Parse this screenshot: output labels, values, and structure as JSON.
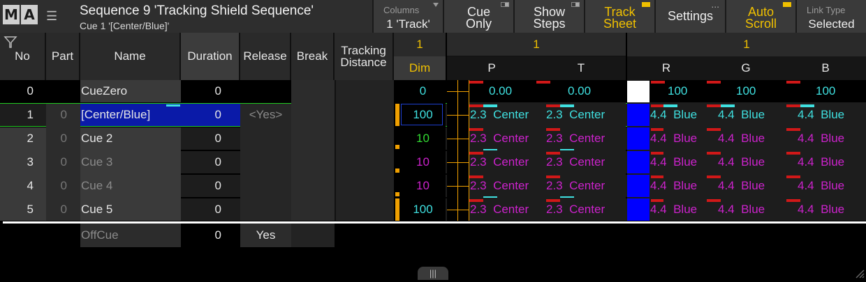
{
  "logo": [
    "M",
    "A"
  ],
  "title": {
    "sequence": "Sequence 9 'Tracking Shield Sequence'",
    "cue": "Cue 1 '[Center/Blue]'"
  },
  "toolbar": {
    "columns_caption": "Columns",
    "columns_value": "1 'Track'",
    "cue_only": [
      "Cue",
      "Only"
    ],
    "show_steps": [
      "Show",
      "Steps"
    ],
    "track_sheet": [
      "Track",
      "Sheet"
    ],
    "settings": "Settings",
    "auto_scroll": [
      "Auto",
      "Scroll"
    ],
    "link_type_caption": "Link Type",
    "link_type_value": "Selected"
  },
  "headers": {
    "no": "No",
    "part": "Part",
    "name": "Name",
    "duration": "Duration",
    "release": "Release",
    "break": "Break",
    "tracking_distance": [
      "Tracking",
      "Distance"
    ],
    "fixture_ids": [
      "1",
      "1",
      "1"
    ],
    "dim": "Dim",
    "position_attrs": [
      "P",
      "T"
    ],
    "color_attrs": [
      "R",
      "G",
      "B"
    ]
  },
  "rows": [
    {
      "no": "0",
      "part": "",
      "name": "CueZero",
      "duration": "0",
      "release": "",
      "dim": "0",
      "pan": "0.00",
      "tilt": "0.00",
      "r": "100",
      "g": "100",
      "b": "100"
    },
    {
      "no": "1",
      "part": "0",
      "name": "[Center/Blue]",
      "duration": "0",
      "release": "<Yes>",
      "dim": "100",
      "pan": "2.3  Center",
      "tilt": "2.3  Center",
      "r": "4.4  Blue",
      "g": "4.4  Blue",
      "b": "4.4  Blue"
    },
    {
      "no": "2",
      "part": "0",
      "name": "Cue  2",
      "duration": "0",
      "release": "",
      "dim": "10",
      "pan": "2.3  Center",
      "tilt": "2.3  Center",
      "r": "4.4  Blue",
      "g": "4.4  Blue",
      "b": "4.4  Blue"
    },
    {
      "no": "3",
      "part": "0",
      "name": "Cue  3",
      "duration": "0",
      "release": "",
      "dim": "10",
      "pan": "2.3  Center",
      "tilt": "2.3  Center",
      "r": "4.4  Blue",
      "g": "4.4  Blue",
      "b": "4.4  Blue"
    },
    {
      "no": "4",
      "part": "0",
      "name": "Cue  4",
      "duration": "0",
      "release": "",
      "dim": "10",
      "pan": "2.3  Center",
      "tilt": "2.3  Center",
      "r": "4.4  Blue",
      "g": "4.4  Blue",
      "b": "4.4  Blue"
    },
    {
      "no": "5",
      "part": "0",
      "name": "Cue  5",
      "duration": "0",
      "release": "",
      "dim": "100",
      "pan": "2.3  Center",
      "tilt": "2.3  Center",
      "r": "4.4  Blue",
      "g": "4.4  Blue",
      "b": "4.4  Blue"
    }
  ],
  "offcue": {
    "name": "OffCue",
    "duration": "0",
    "release": "Yes"
  },
  "colors": {
    "accent_yellow": "#f0c000",
    "cyan": "#3fe0e0",
    "magenta": "#cc22cc",
    "green_dim": "#33dd33",
    "selected_row": "#0a1aa8",
    "swatch_blue": "#0000ff",
    "swatch_white": "#ffffff",
    "tracking_line": "#22cc22"
  },
  "icons": [
    "filter-icon",
    "menu-list-icon",
    "resize-handle-icon"
  ]
}
